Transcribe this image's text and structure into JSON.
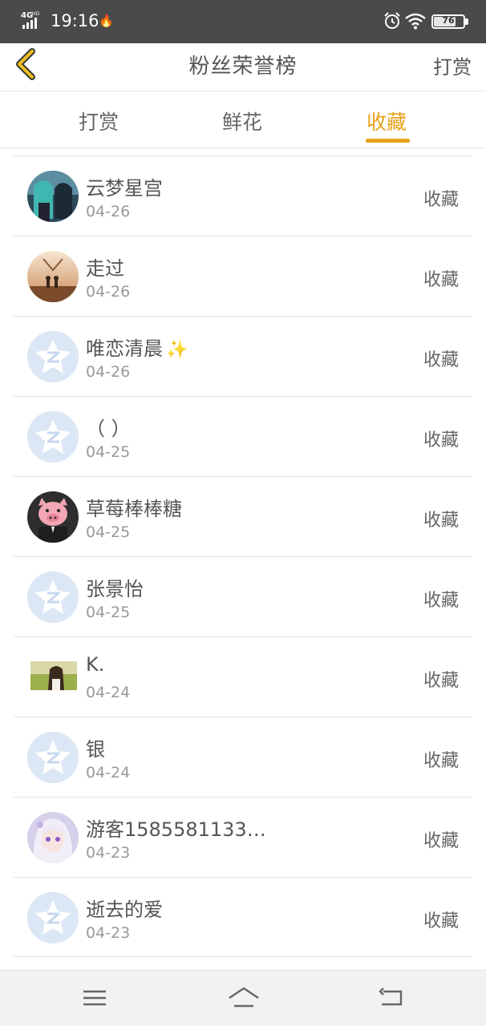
{
  "status": {
    "network": "4G HD",
    "time": "19:16",
    "battery": "76",
    "battery_level": 0.76
  },
  "header": {
    "title": "粉丝荣誉榜",
    "action": "打赏"
  },
  "tabs": [
    {
      "label": "打赏",
      "active": false
    },
    {
      "label": "鲜花",
      "active": false
    },
    {
      "label": "收藏",
      "active": true
    }
  ],
  "accent": "#e8a21a",
  "items": [
    {
      "name": "云梦星宫",
      "date": "04-26",
      "tag": "收藏",
      "avatar": "anime-girls"
    },
    {
      "name": "走过",
      "date": "04-26",
      "tag": "收藏",
      "avatar": "sunset-couple"
    },
    {
      "name": "唯恋清晨",
      "date": "04-26",
      "tag": "收藏",
      "avatar": "default",
      "sparkle": "✨"
    },
    {
      "name": "（ ）",
      "date": "04-25",
      "tag": "收藏",
      "avatar": "default"
    },
    {
      "name": "草莓棒棒糖",
      "date": "04-25",
      "tag": "收藏",
      "avatar": "pig"
    },
    {
      "name": "张景怡",
      "date": "04-25",
      "tag": "收藏",
      "avatar": "default"
    },
    {
      "name": "K.",
      "date": "04-24",
      "tag": "收藏",
      "avatar": "photo-girl"
    },
    {
      "name": "银",
      "date": "04-24",
      "tag": "收藏",
      "avatar": "default"
    },
    {
      "name": "游客1585581133…",
      "date": "04-23",
      "tag": "收藏",
      "avatar": "anime-white-hair"
    },
    {
      "name": "逝去的爱",
      "date": "04-23",
      "tag": "收藏",
      "avatar": "default"
    }
  ],
  "nav": [
    "menu-icon",
    "home-icon",
    "back-icon"
  ]
}
